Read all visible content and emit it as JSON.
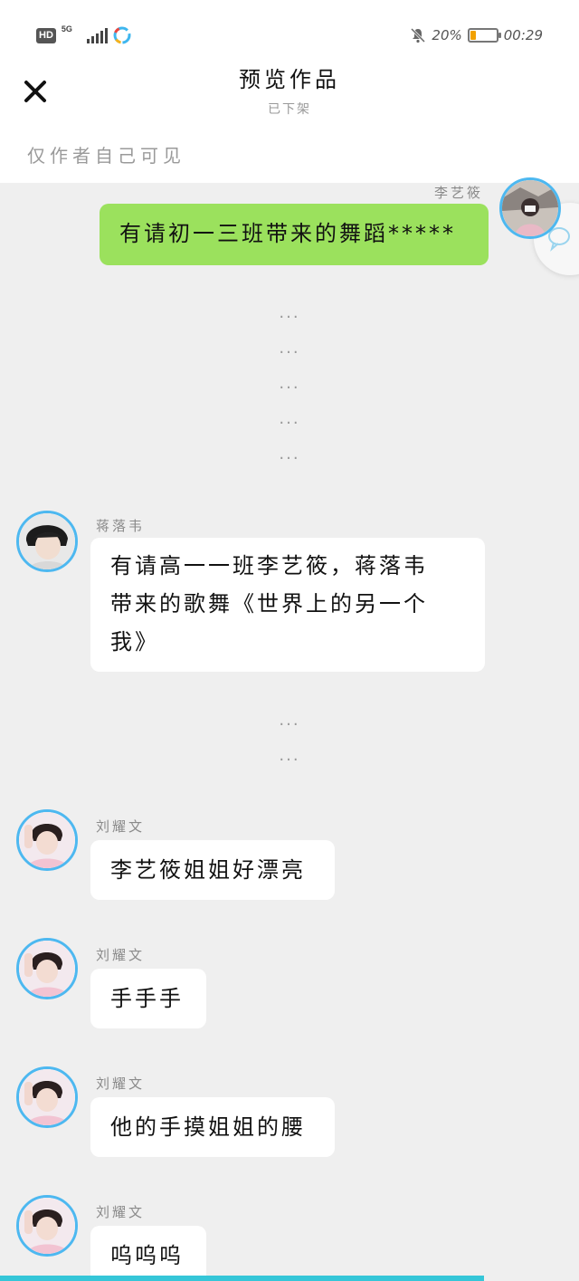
{
  "status_bar": {
    "hd": "HD",
    "network": "5G",
    "battery_percent": "20%",
    "battery_level": 0.2,
    "time": "00:29",
    "icons": [
      "signal-icon",
      "app-icon",
      "mute-bell-icon",
      "battery-icon"
    ]
  },
  "header": {
    "title": "预览作品",
    "subtitle": "已下架",
    "visibility_note": "仅作者自己可见",
    "close_icon": "close-icon"
  },
  "colors": {
    "my_bubble": "#9be15d",
    "other_bubble": "#ffffff",
    "avatar_ring": "#4db8f0",
    "chat_background": "#efefef",
    "bottom_bar": "#35c6d8"
  },
  "messages": [
    {
      "sender": "李艺筱",
      "text": "有请初一三班带来的舞蹈*****",
      "side": "right"
    },
    {
      "dots": [
        "...",
        "...",
        "...",
        "...",
        "..."
      ]
    },
    {
      "sender": "蒋落韦",
      "lines": [
        "有请高一一班李艺筱，蒋落韦",
        "带来的歌舞《世界上的另一个",
        "我》"
      ],
      "side": "left"
    },
    {
      "dots": [
        "...",
        "..."
      ]
    },
    {
      "sender": "刘耀文",
      "text": "李艺筱姐姐好漂亮",
      "side": "left"
    },
    {
      "sender": "刘耀文",
      "text": "手手手",
      "side": "left"
    },
    {
      "sender": "刘耀文",
      "text": "他的手摸姐姐的腰",
      "side": "left"
    },
    {
      "sender": "刘耀文",
      "text": "呜呜呜",
      "side": "left"
    }
  ]
}
